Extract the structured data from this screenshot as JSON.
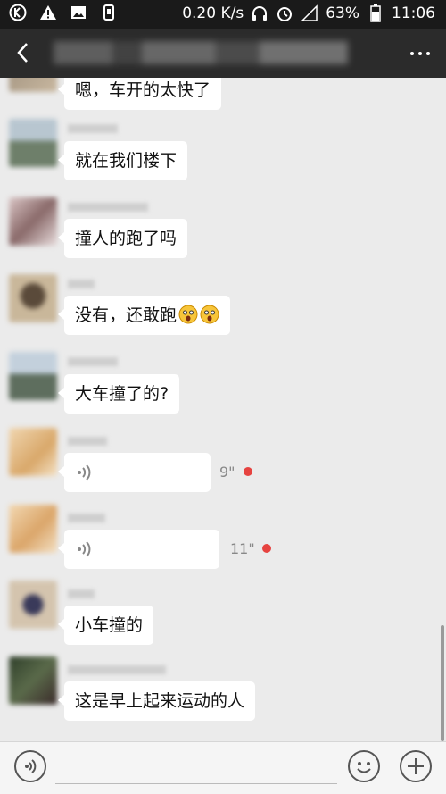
{
  "status_bar": {
    "speed": "0.20 K/s",
    "battery": "63%",
    "time": "11:06",
    "icons": [
      "k-app-icon",
      "warning-icon",
      "image-icon",
      "phone-icon",
      "headphones-icon",
      "alarm-icon",
      "signal-icon",
      "battery-icon"
    ]
  },
  "nav": {
    "icons": [
      "back-icon",
      "more-icon"
    ]
  },
  "messages": [
    {
      "type": "text",
      "text": "嗯，车开的太快了"
    },
    {
      "type": "text",
      "text": "就在我们楼下"
    },
    {
      "type": "text",
      "text": "撞人的跑了吗"
    },
    {
      "type": "text",
      "text": "没有，还敢跑",
      "emoji_count": 2
    },
    {
      "type": "text",
      "text": "大车撞了的?"
    },
    {
      "type": "voice",
      "duration": "9\"",
      "unread": true
    },
    {
      "type": "voice",
      "duration": "11\"",
      "unread": true
    },
    {
      "type": "text",
      "text": "小车撞的"
    },
    {
      "type": "text",
      "text": "这是早上起来运动的人"
    }
  ],
  "input_bar": {
    "icons": [
      "voice-icon",
      "emoji-icon",
      "add-icon"
    ]
  },
  "colors": {
    "status_bar": "#1a1a1a",
    "nav_bar": "#2b2b2b",
    "chat_bg": "#ebebeb",
    "unread_dot": "#e64340"
  }
}
